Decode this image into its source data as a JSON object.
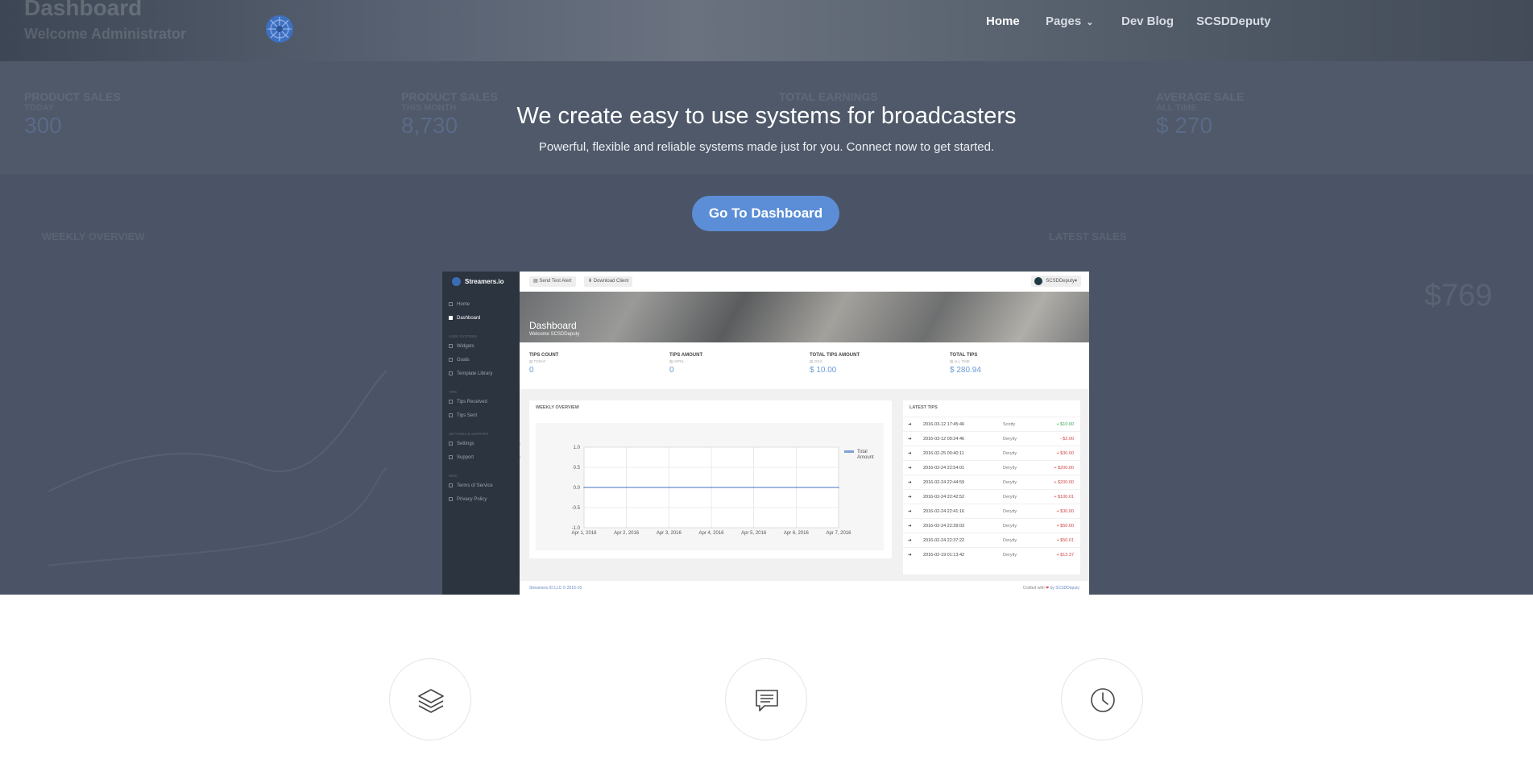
{
  "background_dashboard": {
    "title": "Dashboard",
    "subtitle": "Welcome Administrator",
    "stats": [
      {
        "label": "PRODUCT SALES",
        "sub": "TODAY",
        "value": "300"
      },
      {
        "label": "PRODUCT SALES",
        "sub": "THIS MONTH",
        "value": "8,730"
      },
      {
        "label": "TOTAL EARNINGS",
        "sub": "",
        "value": ""
      },
      {
        "label": "AVERAGE SALE",
        "sub": "ALL TIME",
        "value": "$ 270"
      }
    ],
    "weekly_overview": "WEEKLY OVERVIEW",
    "latest_sales": "LATEST SALES",
    "sales_value": "$769"
  },
  "nav": {
    "items": [
      {
        "label": "Home",
        "active": true
      },
      {
        "label": "Pages",
        "has_dropdown": true
      },
      {
        "label": "Dev Blog"
      },
      {
        "label": "SCSDDeputy"
      }
    ]
  },
  "hero": {
    "title": "We create easy to use systems for broadcasters",
    "subtitle": "Powerful, flexible and reliable systems made just for you. Connect now to get started.",
    "cta_label": "Go To Dashboard"
  },
  "mock": {
    "brand": "Streamers.io",
    "sidebar": [
      {
        "type": "item",
        "label": "Home"
      },
      {
        "type": "item",
        "label": "Dashboard",
        "active": true
      },
      {
        "type": "head",
        "label": "USER SYSTEMS"
      },
      {
        "type": "item",
        "label": "Widgets"
      },
      {
        "type": "item",
        "label": "Goals"
      },
      {
        "type": "item",
        "label": "Template Library"
      },
      {
        "type": "head",
        "label": "TIPS"
      },
      {
        "type": "item",
        "label": "Tips Received"
      },
      {
        "type": "item",
        "label": "Tips Sent"
      },
      {
        "type": "head",
        "label": "SETTINGS & SUPPORT"
      },
      {
        "type": "item",
        "label": "Settings",
        "caret": true
      },
      {
        "type": "item",
        "label": "Support",
        "caret": true
      },
      {
        "type": "head",
        "label": "MISC"
      },
      {
        "type": "item",
        "label": "Terms of Service"
      },
      {
        "type": "item",
        "label": "Privacy Policy"
      }
    ],
    "topbar": {
      "send_test_alert": "Send Test Alert",
      "download_client": "Download Client",
      "user": "SCSDDeputy"
    },
    "banner": {
      "title": "Dashboard",
      "subtitle": "Welcome SCSDDeputy"
    },
    "stats": [
      {
        "label": "TIPS COUNT",
        "sub": "TODAY",
        "value": "0"
      },
      {
        "label": "TIPS AMOUNT",
        "sub": "APRIL",
        "value": "0"
      },
      {
        "label": "TOTAL TIPS AMOUNT",
        "sub": "2016",
        "value": "$ 10.00"
      },
      {
        "label": "TOTAL TIPS",
        "sub": "ALL TIME",
        "value": "$ 280.94"
      }
    ],
    "weekly_overview_title": "WEEKLY OVERVIEW",
    "latest_tips_title": "LATEST TIPS",
    "tips": [
      {
        "date": "2016-03-12 17:45:46",
        "name": "Scotty",
        "amount": "+ $10.00",
        "color": "#3aa655"
      },
      {
        "date": "2016-03-12 00:24:46",
        "name": "Deryity",
        "amount": "- $2.00",
        "color": "#d04848"
      },
      {
        "date": "2016-02-25 00:40:11",
        "name": "Deryity",
        "amount": "+ $30.00",
        "color": "#d04848"
      },
      {
        "date": "2016-02-24 22:54:01",
        "name": "Deryity",
        "amount": "+ $200.00",
        "color": "#d04848"
      },
      {
        "date": "2016-02-24 22:44:59",
        "name": "Deryity",
        "amount": "+ $200.00",
        "color": "#d04848"
      },
      {
        "date": "2016-02-24 22:42:52",
        "name": "Deryity",
        "amount": "+ $100.01",
        "color": "#d04848"
      },
      {
        "date": "2016-02-24 22:41:16",
        "name": "Deryity",
        "amount": "+ $30.00",
        "color": "#d04848"
      },
      {
        "date": "2016-02-24 22:39:03",
        "name": "Deryity",
        "amount": "+ $50.00",
        "color": "#d04848"
      },
      {
        "date": "2016-02-24 22:37:22",
        "name": "Deryity",
        "amount": "+ $50.01",
        "color": "#d04848"
      },
      {
        "date": "2016-02-19 01:13:42",
        "name": "Deryity",
        "amount": "+ $13.37",
        "color": "#d04848"
      }
    ],
    "footer_left": "Streamers.IO LLC © 2015-16",
    "footer_crafted": "Crafted with",
    "footer_by": "by SCSDDeputy"
  },
  "chart_data": {
    "type": "line",
    "x": [
      "Apr 1, 2016",
      "Apr 2, 2016",
      "Apr 3, 2016",
      "Apr 4, 2016",
      "Apr 5, 2016",
      "Apr 6, 2016",
      "Apr 7, 2016"
    ],
    "series": [
      {
        "name": "Total Amount",
        "values": [
          0,
          0,
          0,
          0,
          0,
          0,
          0
        ],
        "color": "#7fa0d8"
      }
    ],
    "yticks": [
      "1.0",
      "0.5",
      "0.0",
      "-0.5",
      "-1.0"
    ],
    "ylim": [
      -1.0,
      1.0
    ],
    "grid": true,
    "legend": "top-right"
  },
  "features": [
    {
      "icon": "layers-icon"
    },
    {
      "icon": "chat-icon"
    },
    {
      "icon": "clock-icon"
    }
  ],
  "colors": {
    "accent": "#5b8ed6",
    "hero_bg": "#4a5466",
    "sidebar": "#2c343f"
  }
}
